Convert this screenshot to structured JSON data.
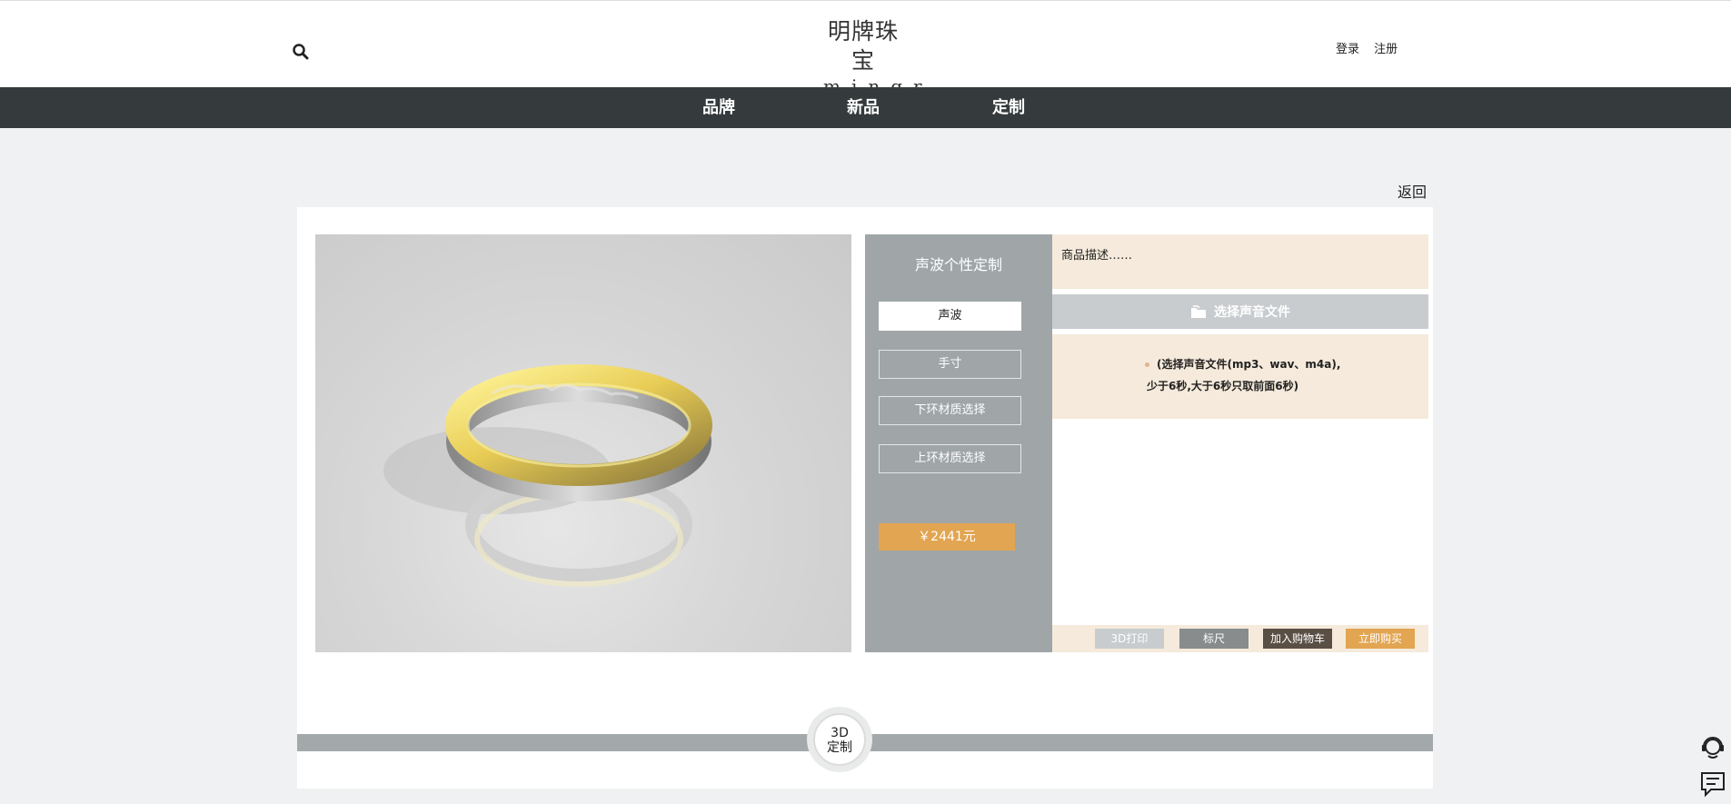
{
  "header": {
    "logo_cn": "明牌珠宝",
    "logo_en": "mingr",
    "login": "登录",
    "register": "注册"
  },
  "nav": [
    {
      "label": "品牌"
    },
    {
      "label": "新品"
    },
    {
      "label": "定制"
    }
  ],
  "back_label": "返回",
  "options": {
    "title": "声波个性定制",
    "items": [
      {
        "label": "声波"
      },
      {
        "label": "手寸"
      },
      {
        "label": "下环材质选择"
      },
      {
        "label": "上环材质选择"
      }
    ],
    "price": "￥2441元"
  },
  "description": "商品描述……",
  "choose_file_label": "选择声音文件",
  "hint": {
    "line1": "(选择声音文件(mp3、wav、m4a),",
    "line2": "少于6秒,大于6秒只取前面6秒)"
  },
  "actions": [
    {
      "label": "3D打印",
      "color": "#c8ccce"
    },
    {
      "label": "标尺",
      "color": "#888c8d"
    },
    {
      "label": "加入购物车",
      "color": "#5a4f45"
    },
    {
      "label": "立即购买",
      "color": "#e2a551"
    }
  ],
  "badge": {
    "line1": "3D",
    "line2": "定制"
  },
  "colors": {
    "nav": "#353b3c",
    "accent": "#e2a551",
    "panel": "#a0a6a8",
    "cream": "#f5eadb"
  }
}
